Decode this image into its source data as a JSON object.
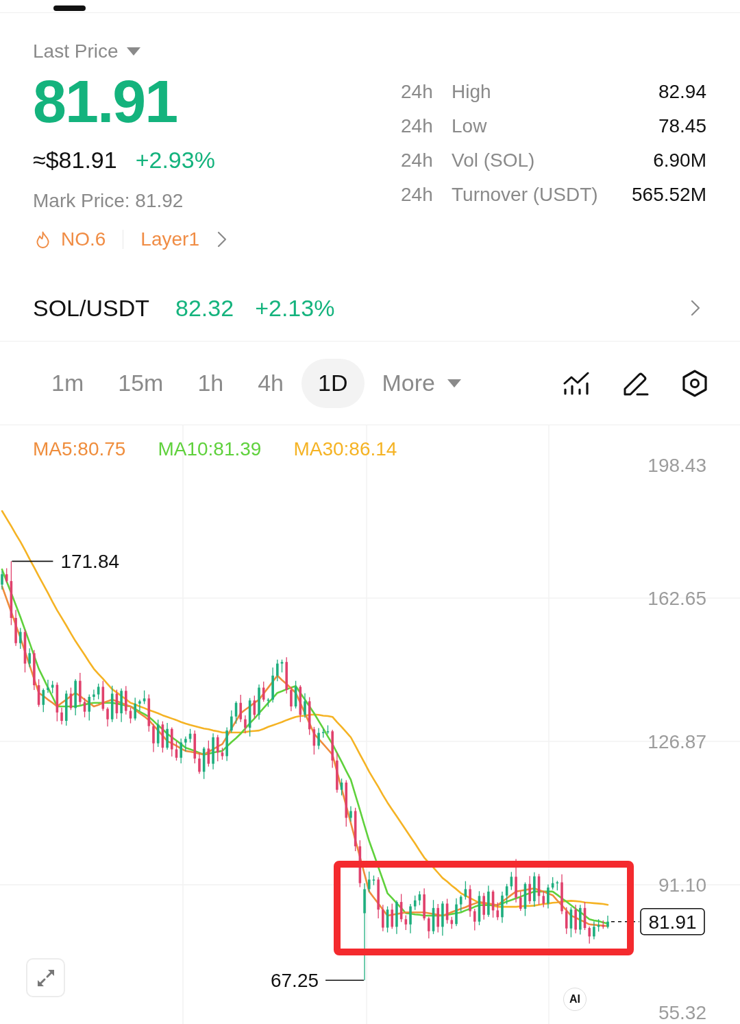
{
  "price_panel": {
    "price_type": "Last Price",
    "last_price": "81.91",
    "usd_price": "≈$81.91",
    "change": "+2.93%",
    "mark_price": "Mark Price: 81.92",
    "rank": "NO.6",
    "category": "Layer1"
  },
  "stats_24h": [
    {
      "period": "24h",
      "label": "High",
      "value": "82.94"
    },
    {
      "period": "24h",
      "label": "Low",
      "value": "78.45"
    },
    {
      "period": "24h",
      "label": "Vol (SOL)",
      "value": "6.90M"
    },
    {
      "period": "24h",
      "label": "Turnover (USDT)",
      "value": "565.52M"
    }
  ],
  "spot_pair": {
    "symbol": "SOL/USDT",
    "price": "82.32",
    "change": "+2.13%"
  },
  "intervals": [
    {
      "label": "1m",
      "selected": false
    },
    {
      "label": "15m",
      "selected": false
    },
    {
      "label": "1h",
      "selected": false
    },
    {
      "label": "4h",
      "selected": false
    },
    {
      "label": "1D",
      "selected": true
    }
  ],
  "more_menu": {
    "label": "More"
  },
  "chart": {
    "chart_data": {
      "type": "candlestick",
      "grid": true,
      "ylim": [
        55.32,
        205.79
      ],
      "yticks": [
        {
          "value": 198.43,
          "label": "198.43"
        },
        {
          "value": 162.65,
          "label": "162.65"
        },
        {
          "value": 126.87,
          "label": "126.87"
        },
        {
          "value": 91.1,
          "label": "91.10"
        },
        {
          "value": 55.32,
          "label": "55.32"
        }
      ],
      "ohlc": [
        [
          166.0,
          169.4,
          164.8,
          168.6
        ],
        [
          168.6,
          170.1,
          166.4,
          166.9
        ],
        [
          166.9,
          171.84,
          155.9,
          157.7
        ],
        [
          157.7,
          159.7,
          150.7,
          151.4
        ],
        [
          151.4,
          155.2,
          150.0,
          154.2
        ],
        [
          154.2,
          154.8,
          144.1,
          146.3
        ],
        [
          146.3,
          150.1,
          145.4,
          148.9
        ],
        [
          148.9,
          149.7,
          139.7,
          140.9
        ],
        [
          140.9,
          142.4,
          135.5,
          136.0
        ],
        [
          136.0,
          140.1,
          134.2,
          139.7
        ],
        [
          139.7,
          142.3,
          139.0,
          140.3
        ],
        [
          140.3,
          142.0,
          138.9,
          141.0
        ],
        [
          141.0,
          141.6,
          131.9,
          134.1
        ],
        [
          134.1,
          135.3,
          131.1,
          132.0
        ],
        [
          132.0,
          139.6,
          130.8,
          138.8
        ],
        [
          138.8,
          140.3,
          134.7,
          135.2
        ],
        [
          135.2,
          142.4,
          133.4,
          142.0
        ],
        [
          142.0,
          144.0,
          136.0,
          136.7
        ],
        [
          136.7,
          137.7,
          132.9,
          134.3
        ],
        [
          134.3,
          138.6,
          132.1,
          138.0
        ],
        [
          138.0,
          139.8,
          137.1,
          138.6
        ],
        [
          138.6,
          141.3,
          137.4,
          140.5
        ],
        [
          140.5,
          142.0,
          134.5,
          135.0
        ],
        [
          135.0,
          135.4,
          130.6,
          132.4
        ],
        [
          132.4,
          140.8,
          131.7,
          138.8
        ],
        [
          138.8,
          139.8,
          132.5,
          133.9
        ],
        [
          133.9,
          140.1,
          131.7,
          139.5
        ],
        [
          139.5,
          140.7,
          133.6,
          134.5
        ],
        [
          134.5,
          135.3,
          131.4,
          132.6
        ],
        [
          132.6,
          137.8,
          132.1,
          136.3
        ],
        [
          136.3,
          137.3,
          134.5,
          136.9
        ],
        [
          136.9,
          139.6,
          136.2,
          137.6
        ],
        [
          137.6,
          138.6,
          129.3,
          130.7
        ],
        [
          130.7,
          131.3,
          124.2,
          126.4
        ],
        [
          126.4,
          132.3,
          125.5,
          131.1
        ],
        [
          131.1,
          131.9,
          124.1,
          125.3
        ],
        [
          125.3,
          131.5,
          124.8,
          130.0
        ],
        [
          130.0,
          130.4,
          123.1,
          124.9
        ],
        [
          124.9,
          126.9,
          122.1,
          122.8
        ],
        [
          122.8,
          127.6,
          121.4,
          126.6
        ],
        [
          126.6,
          128.1,
          124.4,
          127.5
        ],
        [
          127.5,
          130.0,
          126.6,
          128.8
        ],
        [
          128.8,
          129.6,
          121.4,
          122.6
        ],
        [
          122.6,
          124.1,
          118.8,
          119.3
        ],
        [
          119.3,
          125.5,
          117.5,
          125.1
        ],
        [
          125.1,
          127.1,
          120.6,
          121.3
        ],
        [
          121.3,
          128.9,
          119.9,
          127.9
        ],
        [
          127.9,
          128.5,
          121.9,
          124.1
        ],
        [
          124.1,
          125.3,
          122.3,
          123.2
        ],
        [
          123.2,
          130.4,
          122.0,
          129.6
        ],
        [
          129.6,
          134.6,
          129.1,
          133.1
        ],
        [
          133.1,
          136.9,
          131.3,
          136.5
        ],
        [
          136.5,
          138.5,
          131.7,
          132.4
        ],
        [
          132.4,
          133.4,
          128.9,
          130.3
        ],
        [
          130.3,
          137.7,
          128.1,
          137.1
        ],
        [
          137.1,
          138.3,
          132.6,
          133.5
        ],
        [
          133.5,
          141.1,
          132.3,
          140.3
        ],
        [
          140.3,
          141.8,
          136.8,
          137.3
        ],
        [
          137.3,
          137.7,
          135.5,
          137.3
        ],
        [
          137.3,
          145.3,
          136.6,
          143.3
        ],
        [
          143.3,
          147.3,
          141.9,
          146.3
        ],
        [
          146.3,
          147.3,
          144.1,
          146.7
        ],
        [
          146.7,
          147.9,
          138.8,
          139.7
        ],
        [
          139.7,
          140.5,
          134.4,
          135.6
        ],
        [
          135.6,
          142.0,
          135.1,
          140.5
        ],
        [
          140.5,
          140.9,
          131.7,
          133.5
        ],
        [
          133.5,
          138.9,
          132.8,
          136.9
        ],
        [
          136.9,
          137.9,
          128.5,
          129.9
        ],
        [
          129.9,
          130.5,
          123.6,
          125.8
        ],
        [
          125.8,
          130.2,
          124.9,
          129.0
        ],
        [
          129.0,
          130.0,
          127.8,
          129.2
        ],
        [
          129.2,
          130.9,
          128.7,
          129.4
        ],
        [
          129.4,
          129.8,
          120.3,
          122.1
        ],
        [
          122.1,
          124.1,
          114.1,
          114.8
        ],
        [
          114.8,
          117.6,
          113.4,
          116.6
        ],
        [
          116.6,
          117.2,
          105.6,
          107.8
        ],
        [
          107.8,
          110.7,
          106.9,
          109.5
        ],
        [
          109.5,
          110.3,
          99.5,
          100.7
        ],
        [
          100.7,
          102.2,
          90.5,
          91.5
        ],
        [
          84.0,
          91.5,
          67.25,
          90.0
        ],
        [
          90.0,
          94.4,
          89.3,
          92.4
        ],
        [
          92.4,
          93.4,
          91.0,
          92.4
        ],
        [
          92.4,
          93.0,
          82.7,
          84.9
        ],
        [
          84.9,
          86.1,
          79.5,
          80.4
        ],
        [
          80.4,
          85.7,
          79.2,
          84.9
        ],
        [
          84.9,
          86.4,
          80.1,
          80.6
        ],
        [
          80.6,
          87.2,
          78.8,
          86.8
        ],
        [
          86.8,
          88.8,
          81.8,
          82.5
        ],
        [
          82.5,
          83.5,
          79.8,
          81.2
        ],
        [
          81.2,
          86.3,
          79.0,
          85.7
        ],
        [
          85.7,
          88.4,
          84.8,
          87.2
        ],
        [
          87.2,
          89.5,
          86.0,
          88.7
        ],
        [
          88.7,
          90.2,
          82.2,
          82.7
        ],
        [
          82.7,
          83.1,
          77.7,
          79.5
        ],
        [
          79.5,
          87.3,
          78.8,
          85.3
        ],
        [
          85.3,
          86.3,
          79.2,
          80.6
        ],
        [
          80.6,
          87.0,
          78.4,
          86.4
        ],
        [
          86.4,
          87.6,
          81.4,
          82.3
        ],
        [
          82.3,
          83.1,
          80.1,
          81.3
        ],
        [
          81.3,
          87.7,
          80.8,
          86.2
        ],
        [
          86.2,
          88.5,
          84.4,
          88.1
        ],
        [
          88.1,
          92.0,
          87.4,
          90.0
        ],
        [
          90.0,
          91.0,
          83.1,
          84.5
        ],
        [
          84.5,
          85.1,
          79.7,
          81.9
        ],
        [
          81.9,
          89.5,
          81.0,
          88.3
        ],
        [
          88.3,
          89.1,
          82.4,
          83.6
        ],
        [
          83.6,
          90.9,
          83.1,
          89.4
        ],
        [
          89.4,
          89.8,
          82.9,
          84.7
        ],
        [
          84.7,
          86.7,
          82.3,
          83.0
        ],
        [
          83.0,
          89.4,
          81.6,
          88.4
        ],
        [
          88.4,
          91.3,
          86.2,
          90.7
        ],
        [
          90.7,
          94.3,
          89.8,
          93.1
        ],
        [
          93.1,
          97.5,
          86.7,
          87.9
        ],
        [
          87.9,
          89.4,
          84.6,
          85.1
        ],
        [
          85.1,
          91.7,
          83.3,
          91.3
        ],
        [
          91.3,
          93.3,
          86.3,
          87.0
        ],
        [
          87.0,
          94.2,
          85.6,
          93.2
        ],
        [
          93.2,
          93.8,
          86.1,
          88.3
        ],
        [
          88.3,
          89.5,
          85.5,
          86.4
        ],
        [
          86.4,
          91.2,
          85.2,
          90.4
        ],
        [
          90.4,
          93.0,
          89.9,
          91.5
        ],
        [
          91.5,
          92.1,
          89.7,
          91.7
        ],
        [
          91.7,
          93.7,
          83.8,
          84.5
        ],
        [
          84.5,
          85.5,
          78.8,
          80.2
        ],
        [
          80.2,
          85.5,
          78.0,
          84.9
        ],
        [
          84.9,
          86.1,
          79.0,
          79.9
        ],
        [
          79.9,
          86.1,
          78.7,
          85.3
        ],
        [
          85.3,
          86.8,
          79.8,
          80.3
        ],
        [
          80.3,
          80.7,
          76.4,
          78.2
        ],
        [
          78.2,
          82.0,
          77.5,
          80.6
        ],
        [
          80.6,
          82.5,
          79.4,
          81.0
        ],
        [
          81.0,
          82.2,
          80.1,
          80.6
        ],
        [
          80.6,
          83.4,
          80.2,
          81.9
        ]
      ],
      "series": [
        {
          "name": "MA5:80.75",
          "type": "line",
          "color": "#ef8d3c",
          "values": [
            165.6,
            162.4,
            159.2,
            155.9,
            152.7,
            149.3,
            145.9,
            142.4,
            139.0,
            138.2,
            137.3,
            136.5,
            135.6,
            136.5,
            137.3,
            138.2,
            139.0,
            138.2,
            137.3,
            136.5,
            135.6,
            136.0,
            136.5,
            136.9,
            137.3,
            136.9,
            136.5,
            136.0,
            135.6,
            134.8,
            133.9,
            133.1,
            132.2,
            130.9,
            129.6,
            128.3,
            127.0,
            126.4,
            125.8,
            125.1,
            124.5,
            124.3,
            124.1,
            123.8,
            123.6,
            124.3,
            124.9,
            125.6,
            126.2,
            128.1,
            130.1,
            132.0,
            133.9,
            134.8,
            135.6,
            136.5,
            137.3,
            138.8,
            140.3,
            141.8,
            143.3,
            142.2,
            141.2,
            140.1,
            139.0,
            136.5,
            133.9,
            131.4,
            128.8,
            127.5,
            126.2,
            124.9,
            123.6,
            119.3,
            115.1,
            110.8,
            106.5,
            102.2,
            98.0,
            93.7,
            89.4,
            87.9,
            86.4,
            84.9,
            83.4,
            83.6,
            83.8,
            84.0,
            84.2,
            84.2,
            84.2,
            84.2,
            84.2,
            84.0,
            83.8,
            83.6,
            83.4,
            83.8,
            84.3,
            84.7,
            85.1,
            85.5,
            86.0,
            86.4,
            86.8,
            86.6,
            86.4,
            86.2,
            86.0,
            86.9,
            87.7,
            88.6,
            89.4,
            89.6,
            89.8,
            90.0,
            90.2,
            89.8,
            89.4,
            88.9,
            88.5,
            87.2,
            86.0,
            84.7,
            83.4,
            82.9,
            82.3,
            81.8,
            81.2,
            81.1,
            81.0,
            80.9,
            80.8
          ]
        },
        {
          "name": "MA10:81.39",
          "type": "line",
          "color": "#5fd13c",
          "values": [
            169.8,
            166.8,
            163.9,
            160.9,
            157.9,
            154.7,
            151.5,
            148.2,
            145.0,
            142.7,
            140.3,
            138.0,
            135.6,
            135.6,
            135.6,
            135.6,
            135.6,
            135.8,
            136.1,
            136.3,
            136.5,
            136.5,
            136.5,
            136.5,
            136.5,
            136.3,
            136.1,
            135.8,
            135.6,
            135.0,
            134.3,
            133.7,
            133.0,
            132.0,
            130.9,
            129.9,
            128.8,
            127.9,
            127.1,
            126.2,
            125.3,
            124.9,
            124.5,
            124.0,
            123.6,
            123.8,
            124.1,
            124.3,
            124.5,
            125.6,
            126.7,
            127.7,
            128.8,
            130.1,
            131.4,
            132.6,
            133.9,
            135.2,
            136.5,
            137.7,
            139.0,
            139.4,
            139.9,
            140.3,
            140.7,
            139.0,
            137.3,
            135.6,
            133.9,
            132.0,
            130.1,
            128.1,
            126.2,
            124.0,
            121.8,
            119.5,
            117.3,
            113.5,
            109.7,
            105.8,
            102.0,
            98.8,
            95.5,
            92.3,
            89.0,
            87.8,
            86.5,
            85.3,
            84.0,
            83.9,
            83.7,
            83.6,
            83.4,
            83.4,
            83.4,
            83.4,
            83.4,
            83.6,
            83.8,
            84.0,
            84.2,
            84.7,
            85.1,
            85.6,
            86.0,
            86.0,
            86.0,
            86.0,
            86.0,
            86.4,
            86.9,
            87.3,
            87.7,
            88.1,
            88.6,
            89.0,
            89.4,
            89.4,
            89.4,
            89.4,
            89.4,
            88.6,
            87.7,
            86.9,
            86.0,
            85.1,
            84.3,
            83.4,
            82.5,
            82.2,
            82.0,
            81.7,
            81.4
          ]
        },
        {
          "name": "MA30:86.14",
          "type": "line",
          "color": "#f5b324",
          "values": [
            184.4,
            182.5,
            180.6,
            178.6,
            176.7,
            174.6,
            172.4,
            170.3,
            168.1,
            166.0,
            163.9,
            161.7,
            159.6,
            157.7,
            155.8,
            153.8,
            151.9,
            150.2,
            148.5,
            146.7,
            145.0,
            143.7,
            142.5,
            141.2,
            139.9,
            139.1,
            138.2,
            137.4,
            136.5,
            136.1,
            135.6,
            135.2,
            134.7,
            134.3,
            133.9,
            133.4,
            133.0,
            132.6,
            132.2,
            131.7,
            131.3,
            131.0,
            130.7,
            130.4,
            130.1,
            129.9,
            129.6,
            129.4,
            129.1,
            129.1,
            129.1,
            129.1,
            129.1,
            129.2,
            129.4,
            129.5,
            129.6,
            130.0,
            130.5,
            130.9,
            131.3,
            131.7,
            132.2,
            132.6,
            133.0,
            133.2,
            133.3,
            133.5,
            133.6,
            133.5,
            133.3,
            133.2,
            133.0,
            131.7,
            130.5,
            129.2,
            127.9,
            125.8,
            123.6,
            121.5,
            119.3,
            117.4,
            115.5,
            113.5,
            111.6,
            109.9,
            108.2,
            106.5,
            104.8,
            103.1,
            101.4,
            99.6,
            97.9,
            96.6,
            95.4,
            94.1,
            92.8,
            91.9,
            90.9,
            90.0,
            89.0,
            88.4,
            87.8,
            87.2,
            86.6,
            86.4,
            86.1,
            85.9,
            85.6,
            85.6,
            85.6,
            85.6,
            85.6,
            85.7,
            85.8,
            85.8,
            85.9,
            86.1,
            86.3,
            86.4,
            86.6,
            86.7,
            86.9,
            87.0,
            87.1,
            87.0,
            86.9,
            86.7,
            86.6,
            86.5,
            86.4,
            86.3,
            86.1
          ]
        }
      ]
    },
    "high_label": "171.84",
    "low_label": "67.25",
    "current_price": "81.91",
    "ai_button": "AI"
  }
}
